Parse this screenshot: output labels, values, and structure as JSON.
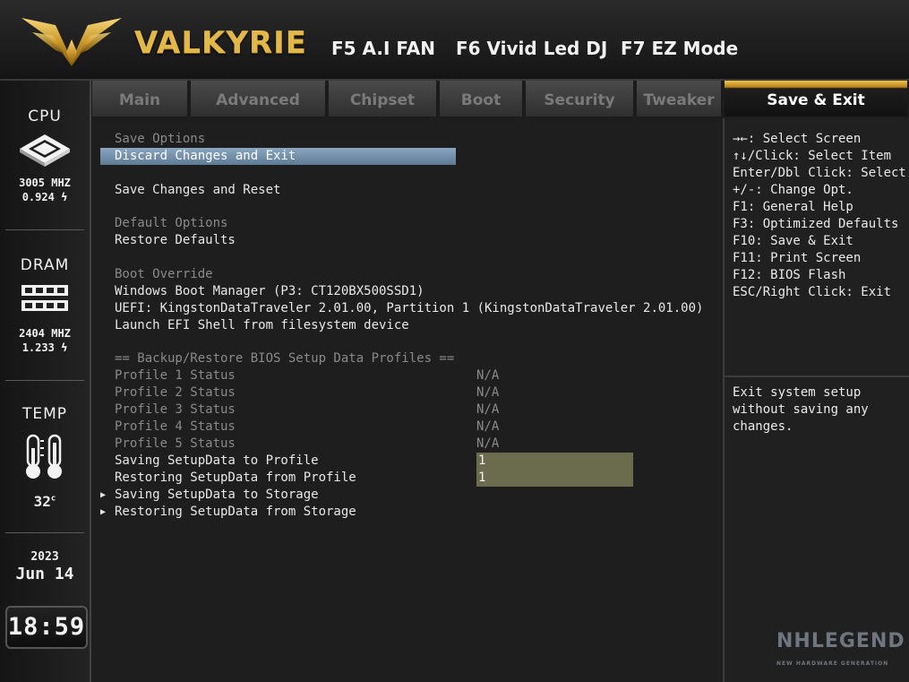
{
  "header": {
    "brand": "VALKYRIE",
    "hotkeys": [
      "F5 A.I FAN",
      "F6 Vivid Led DJ",
      "F7 EZ Mode"
    ]
  },
  "sidebar": {
    "cpu": {
      "label": "CPU",
      "freq": "3005 MHZ",
      "volt": "0.924"
    },
    "dram": {
      "label": "DRAM",
      "freq": "2404 MHZ",
      "volt": "1.233"
    },
    "temp": {
      "label": "TEMP",
      "value": "32",
      "unit": "c"
    },
    "date": {
      "year": "2023",
      "day": "Jun 14"
    },
    "clock": "18:59"
  },
  "tabs": [
    "Main",
    "Advanced",
    "Chipset",
    "Boot",
    "Security",
    "Tweaker",
    "Save & Exit"
  ],
  "active_tab": "Save & Exit",
  "main": {
    "save_options_header": "Save Options",
    "discard_exit": "Discard Changes and Exit",
    "save_reset": "Save Changes and Reset",
    "default_options_header": "Default Options",
    "restore_defaults": "Restore Defaults",
    "boot_override_header": "Boot Override",
    "boot_items": [
      "Windows Boot Manager (P3: CT120BX500SSD1)",
      "UEFI: KingstonDataTraveler 2.01.00, Partition 1 (KingstonDataTraveler 2.01.00)",
      "Launch EFI Shell from filesystem device"
    ],
    "backup_header": "== Backup/Restore BIOS Setup Data Profiles ==",
    "profiles": [
      {
        "label": "Profile 1 Status",
        "value": "N/A"
      },
      {
        "label": "Profile 2 Status",
        "value": "N/A"
      },
      {
        "label": "Profile 3 Status",
        "value": "N/A"
      },
      {
        "label": "Profile 4 Status",
        "value": "N/A"
      },
      {
        "label": "Profile 5 Status",
        "value": "N/A"
      }
    ],
    "saving_profile": {
      "label": "Saving SetupData to Profile",
      "value": "1"
    },
    "restoring_profile": {
      "label": "Restoring SetupData from Profile",
      "value": "1"
    },
    "saving_storage": "Saving SetupData to Storage",
    "restoring_storage": "Restoring SetupData from Storage"
  },
  "help": {
    "keys": [
      "→←: Select Screen",
      "↑↓/Click: Select Item",
      "Enter/Dbl Click: Select",
      "+/-: Change Opt.",
      "F1: General Help",
      "F3: Optimized Defaults",
      "F10: Save & Exit",
      "F11: Print Screen",
      "F12: BIOS Flash",
      "ESC/Right Click: Exit"
    ],
    "description": "Exit system setup\nwithout saving any\nchanges."
  },
  "watermark": {
    "main": "NHLEGEND",
    "sub": "NEW HARDWARE GENERATION"
  },
  "colors": {
    "accent_gold": "#e2b84a",
    "selection": "#7592ad",
    "edit_field": "#6b6b4e",
    "dim_text": "#8a8a8a"
  }
}
